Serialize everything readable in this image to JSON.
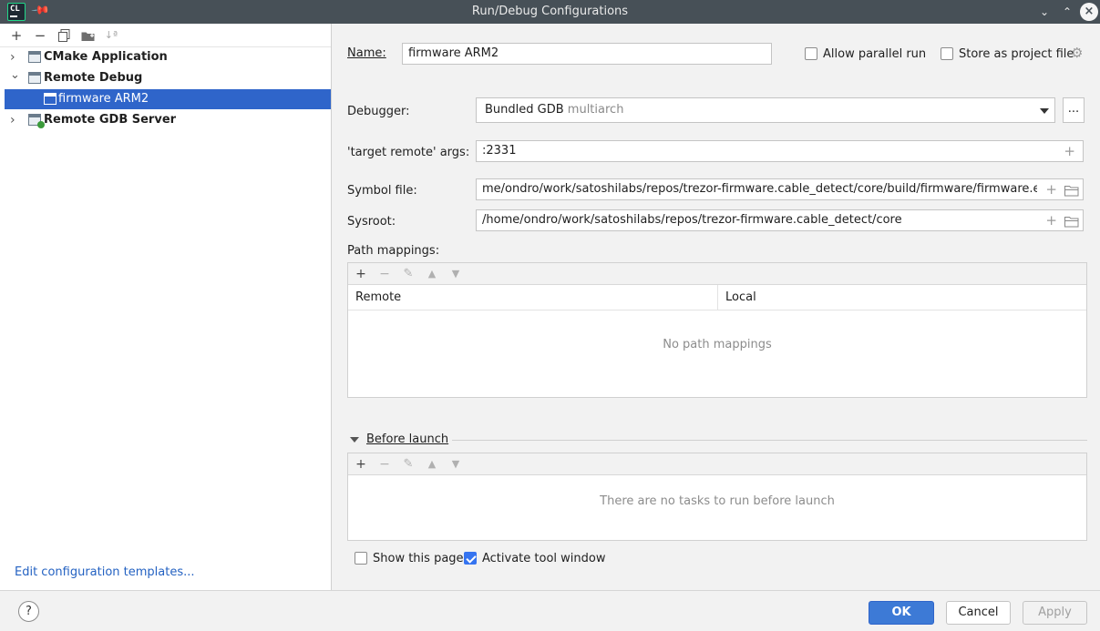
{
  "window": {
    "title": "Run/Debug Configurations",
    "app_icon_text": "CL",
    "minimize_glyph": "⌄",
    "maximize_glyph": "⌃",
    "close_glyph": "×"
  },
  "left_toolbar": {
    "add": "+",
    "remove": "−",
    "copy": "⧉",
    "folder": "▬",
    "sort": "↓ª"
  },
  "tree": [
    {
      "label": "CMake Application",
      "expanded": false,
      "icon": "cmake-app-icon"
    },
    {
      "label": "Remote Debug",
      "expanded": true,
      "icon": "remote-debug-icon"
    },
    {
      "label": "firmware ARM2",
      "selected": true,
      "icon": "remote-debug-config-icon"
    },
    {
      "label": "Remote GDB Server",
      "expanded": false,
      "icon": "remote-gdb-server-icon"
    }
  ],
  "tree_arrows": {
    "collapsed": "›",
    "expanded": "⌄"
  },
  "edit_templates_link": "Edit configuration templates...",
  "form": {
    "name_label": "Name:",
    "name_value": "firmware ARM2",
    "allow_parallel_run_label": "Allow parallel run",
    "allow_parallel_run_checked": false,
    "store_as_project_file_label": "Store as project file",
    "store_as_project_file_checked": false,
    "debugger_label": "Debugger:",
    "debugger_value": "Bundled GDB",
    "debugger_value_suffix": "multiarch",
    "browse_label": "...",
    "target_remote_label": "'target remote' args:",
    "target_remote_value": ":2331",
    "symbol_file_label": "Symbol file:",
    "symbol_file_value": "me/ondro/work/satoshilabs/repos/trezor-firmware.cable_detect/core/build/firmware/firmware.elf",
    "sysroot_label": "Sysroot:",
    "sysroot_value": "/home/ondro/work/satoshilabs/repos/trezor-firmware.cable_detect/core",
    "path_mappings_label": "Path mappings:",
    "path_mappings_columns": [
      "Remote",
      "Local"
    ],
    "path_mappings_empty": "No path mappings",
    "before_launch_label": "Before launch",
    "before_launch_empty": "There are no tasks to run before launch",
    "show_this_page_label": "Show this page",
    "show_this_page_checked": false,
    "activate_tool_window_label": "Activate tool window",
    "activate_tool_window_checked": true
  },
  "toolbar_glyphs": {
    "add": "+",
    "remove": "−",
    "edit": "✎",
    "up": "▲",
    "down": "▼"
  },
  "field_glyphs": {
    "expand": "+",
    "folder": "▭",
    "gear": "⚙"
  },
  "buttons": {
    "help": "?",
    "ok": "OK",
    "cancel": "Cancel",
    "apply": "Apply"
  },
  "colors": {
    "selection": "#2f65ca",
    "ok_button": "#3d7ad6",
    "link": "#2462c2",
    "titlebar": "#475057"
  }
}
